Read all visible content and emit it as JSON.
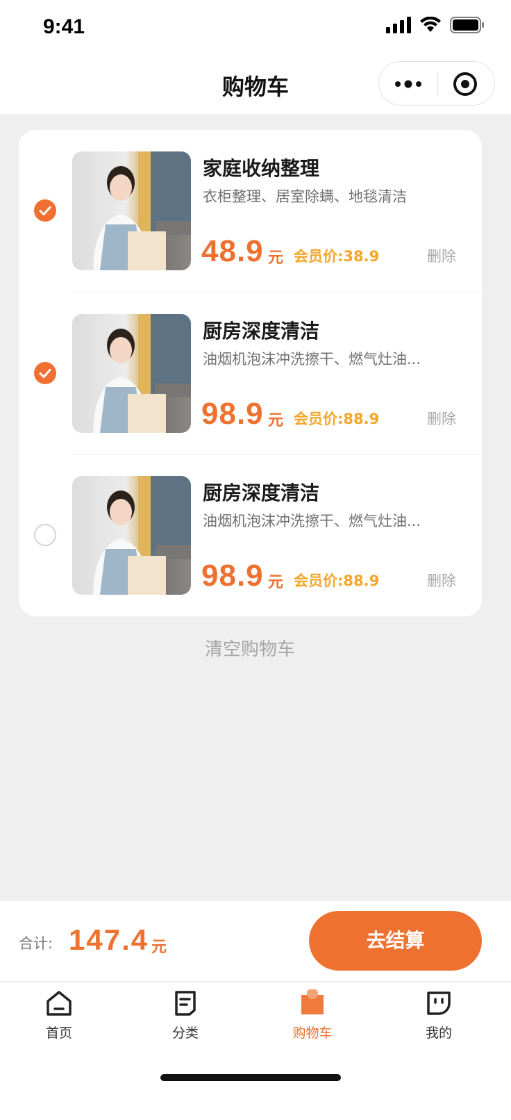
{
  "status_bar": {
    "time": "9:41"
  },
  "header": {
    "title": "购物车"
  },
  "cart": {
    "items": [
      {
        "title": "家庭收纳整理",
        "desc": "衣柜整理、居室除螨、地毯清洁",
        "price": "48.9",
        "unit": "元",
        "member_price": "会员价:38.9",
        "delete_label": "删除",
        "checked": true
      },
      {
        "title": "厨房深度清洁",
        "desc": "油烟机泡沫冲洗擦干、燃气灶油...",
        "price": "98.9",
        "unit": "元",
        "member_price": "会员价:88.9",
        "delete_label": "删除",
        "checked": true
      },
      {
        "title": "厨房深度清洁",
        "desc": "油烟机泡沫冲洗擦干、燃气灶油...",
        "price": "98.9",
        "unit": "元",
        "member_price": "会员价:88.9",
        "delete_label": "删除",
        "checked": false
      }
    ],
    "clear_label": "清空购物车"
  },
  "summary": {
    "label": "合计:",
    "total": "147.4",
    "unit": "元",
    "checkout_label": "去结算"
  },
  "tabbar": {
    "tabs": [
      {
        "label": "首页",
        "icon": "home-icon",
        "active": false
      },
      {
        "label": "分类",
        "icon": "category-icon",
        "active": false
      },
      {
        "label": "购物车",
        "icon": "cart-icon",
        "active": true
      },
      {
        "label": "我的",
        "icon": "profile-icon",
        "active": false
      }
    ]
  },
  "colors": {
    "accent": "#ee7130",
    "member": "#f3a628",
    "background": "#efefef"
  }
}
